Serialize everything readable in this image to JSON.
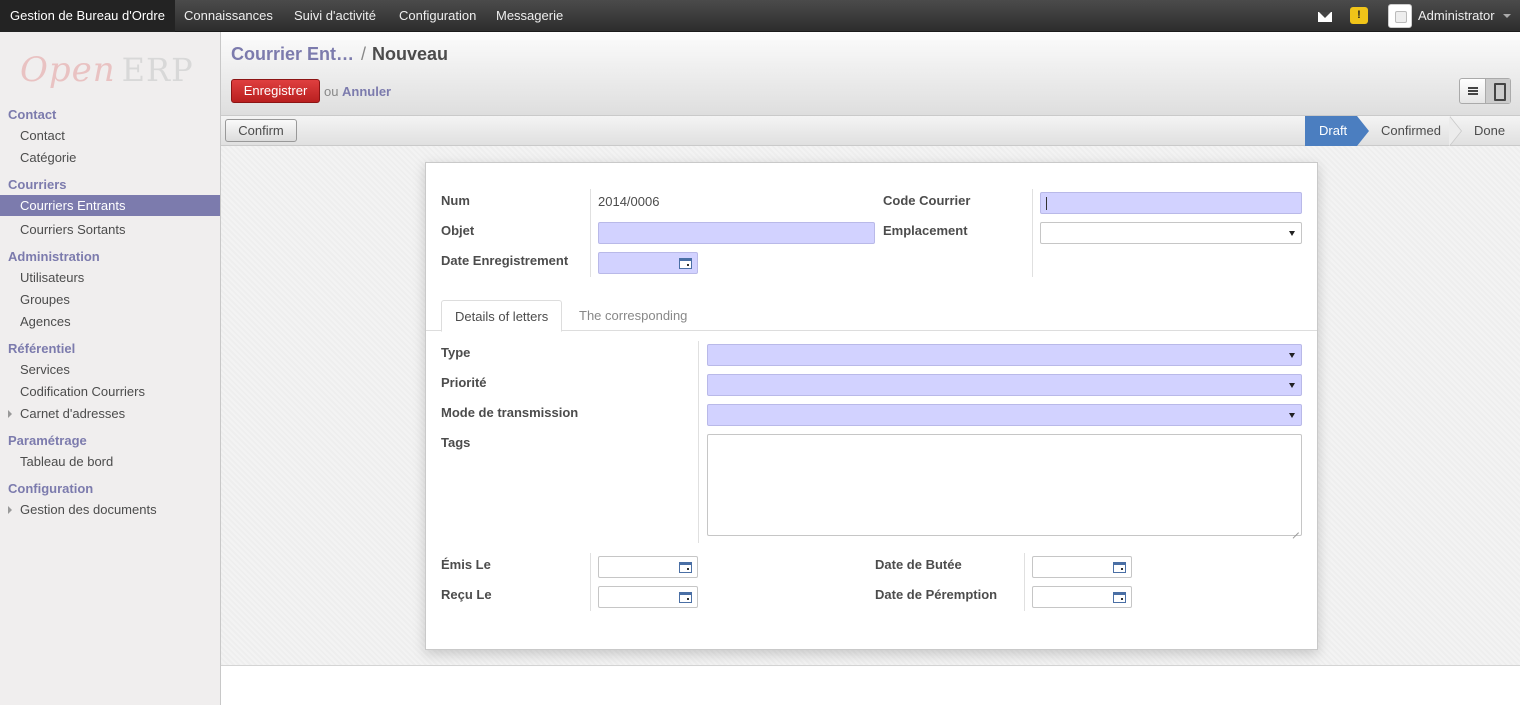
{
  "topbar": {
    "menus": [
      "Gestion de Bureau d'Ordre",
      "Connaissances",
      "Suivi d'activité",
      "Configuration",
      "Messagerie"
    ],
    "user": "Administrator"
  },
  "logo": {
    "open": "Open",
    "erp": "ERP"
  },
  "sidebar": {
    "sections": [
      {
        "title": "Contact",
        "items": [
          "Contact",
          "Catégorie"
        ]
      },
      {
        "title": "Courriers",
        "items": [
          "Courriers Entrants",
          "Courriers Sortants"
        ]
      },
      {
        "title": "Administration",
        "items": [
          "Utilisateurs",
          "Groupes",
          "Agences"
        ]
      },
      {
        "title": "Référentiel",
        "items": [
          "Services",
          "Codification Courriers",
          "Carnet d'adresses"
        ]
      },
      {
        "title": "Paramétrage",
        "items": [
          "Tableau de bord"
        ]
      },
      {
        "title": "Configuration",
        "items": [
          "Gestion des documents"
        ]
      }
    ],
    "active_item": "Courriers Entrants"
  },
  "header": {
    "breadcrumb_link": "Courrier Ent…",
    "separator": "/",
    "current": "Nouveau",
    "save_label": "Enregistrer",
    "or_text": "ou",
    "cancel_label": "Annuler"
  },
  "statusbar": {
    "confirm_label": "Confirm",
    "stages": [
      "Draft",
      "Confirmed",
      "Done"
    ],
    "current_stage": "Draft"
  },
  "form": {
    "num_label": "Num",
    "num_value": "2014/0006",
    "objet_label": "Objet",
    "objet_value": "",
    "date_enr_label": "Date Enregistrement",
    "date_enr_value": "",
    "code_label": "Code Courrier",
    "code_value": "",
    "emplacement_label": "Emplacement",
    "emplacement_value": "",
    "tabs": [
      "Details of letters",
      "The corresponding"
    ],
    "type_label": "Type",
    "type_value": "",
    "priorite_label": "Priorité",
    "priorite_value": "",
    "mode_label": "Mode de transmission",
    "mode_value": "",
    "tags_label": "Tags",
    "tags_value": "",
    "emis_label": "Émis Le",
    "emis_value": "",
    "recu_label": "Reçu Le",
    "recu_value": "",
    "butee_label": "Date de Butée",
    "butee_value": "",
    "peremption_label": "Date de Péremption",
    "peremption_value": ""
  },
  "colors": {
    "accent": "#7c7bad",
    "required_field": "#d2d2ff",
    "save_button": "#c62828",
    "active_stage": "#4b7ec0"
  }
}
